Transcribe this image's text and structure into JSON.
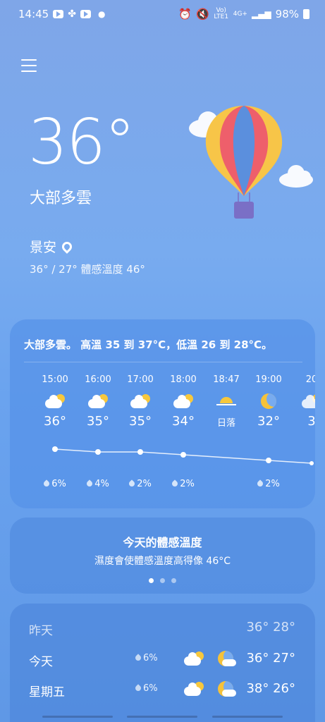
{
  "status_bar": {
    "time": "14:45",
    "left_icons": [
      "youtube-icon",
      "fan-app-icon",
      "youtube-icon",
      "notification-dot-icon"
    ],
    "right_icons": [
      "alarm-icon",
      "mute-icon",
      "volte-icon",
      "4g-icon",
      "signal-icon"
    ],
    "volte_label": "Vo) LTE1",
    "network_label": "4G+",
    "battery": "98%"
  },
  "menu": {
    "icon": "hamburger-menu-icon"
  },
  "current": {
    "temperature": "36°",
    "condition": "大部多雲",
    "location": "景安",
    "range": "36° / 27° 體感溫度 46°"
  },
  "hourly_card": {
    "summary": "大部多雲。 高溫 35 到 37°C，低溫 26 到 28°C。",
    "hours": [
      {
        "time": "15:00",
        "icon": "partly-cloudy-icon",
        "temp": "36°",
        "rain": "6%"
      },
      {
        "time": "16:00",
        "icon": "partly-cloudy-icon",
        "temp": "35°",
        "rain": "4%"
      },
      {
        "time": "17:00",
        "icon": "partly-cloudy-icon",
        "temp": "35°",
        "rain": "2%"
      },
      {
        "time": "18:00",
        "icon": "partly-cloudy-icon",
        "temp": "34°",
        "rain": "2%"
      },
      {
        "time": "18:47",
        "icon": "sunset-icon",
        "temp": "日落",
        "rain": ""
      },
      {
        "time": "19:00",
        "icon": "moon-icon",
        "temp": "32°",
        "rain": "2%"
      },
      {
        "time": "20",
        "icon": "partly-cloudy-night-icon",
        "temp": "3",
        "rain": ""
      }
    ]
  },
  "feels_like_card": {
    "title": "今天的體感溫度",
    "subtitle": "濕度會使體感溫度高得像 46°C",
    "page_count": 3,
    "active_page": 0
  },
  "daily_card": {
    "days": [
      {
        "name": "昨天",
        "rain": "",
        "temps": "36° 28°"
      },
      {
        "name": "今天",
        "rain": "6%",
        "temps": "36° 27°"
      },
      {
        "name": "星期五",
        "rain": "6%",
        "temps": "38° 26°"
      }
    ]
  },
  "colors": {
    "sun": "#f7c83d",
    "balloon_red": "#ee5f6b",
    "balloon_blue": "#5b8fdd",
    "balloon_yellow": "#f7c548",
    "basket": "#7a6fc6"
  }
}
